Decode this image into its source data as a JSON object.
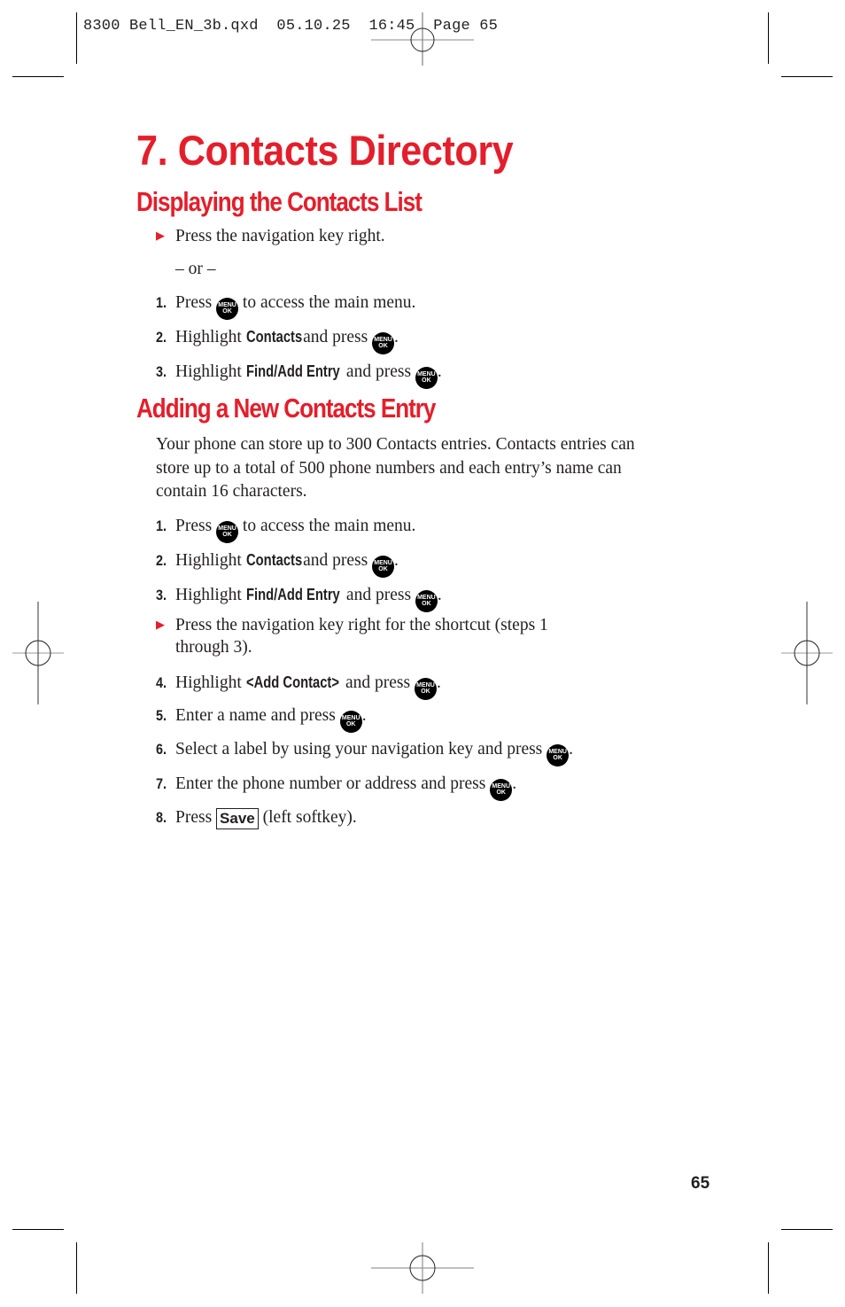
{
  "print_slug": "8300 Bell_EN_3b.qxd  05.10.25  16:45  Page 65",
  "chapter_title": "7. Contacts Directory",
  "sections": [
    {
      "heading": "Displaying the Contacts List",
      "bullet_intro": "Press the navigation key right.",
      "or_separator": "– or –",
      "steps": [
        {
          "num": "1.",
          "pre": "Press",
          "key": "",
          "post": "to access the main menu.",
          "icon": true
        },
        {
          "num": "2.",
          "pre": "Highlight",
          "key": "Contacts",
          "post": "and press",
          "icon": true,
          "tail": "."
        },
        {
          "num": "3.",
          "pre": "Highlight",
          "key": "Find/Add Entry",
          "post": "and press",
          "icon": true,
          "tail": "."
        }
      ]
    },
    {
      "heading": "Adding a New Contacts Entry",
      "paragraph": "Your phone can store up to 300 Contacts entries. Contacts entries can store up to a total of 500 phone numbers and each entry’s name can contain 16 characters.",
      "steps": [
        {
          "num": "1.",
          "pre": "Press",
          "post": "to access the main menu."
        },
        {
          "num": "2.",
          "pre": "Highlight",
          "key": "Contacts",
          "post": "and press",
          "tail": "."
        },
        {
          "num": "3.",
          "pre": "Highlight",
          "key": "Find/Add Entry",
          "post": "and press",
          "tail": "."
        },
        {
          "bullet_line1": "Press the navigation key right for the shortcut (steps 1",
          "bullet_line2": "through 3)."
        },
        {
          "num": "4.",
          "pre": "Highlight",
          "key": "<Add Contact>",
          "post": "and press",
          "tail": "."
        },
        {
          "num": "5.",
          "pre": "Enter a name and press",
          "tail": "."
        },
        {
          "num": "6.",
          "pre": "Select a label by using your navigation key and press",
          "tail": "."
        },
        {
          "num": "7.",
          "pre": "Enter the phone number or address and press",
          "tail": "."
        },
        {
          "num": "8.",
          "pre": "Press",
          "softkey": "Save",
          "post": "(left softkey)."
        }
      ]
    }
  ],
  "menu_key": {
    "top": "MENU",
    "bottom": "OK"
  },
  "bullet_glyph": "▶",
  "page_number": "65",
  "colors": {
    "accent_red": "#e41e2b",
    "text": "#231f20"
  }
}
